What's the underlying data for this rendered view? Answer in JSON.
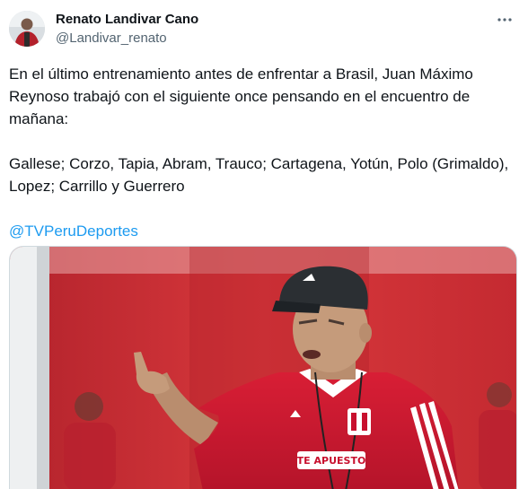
{
  "tweet": {
    "author": {
      "name": "Renato Landivar Cano",
      "handle": "@Landivar_renato"
    },
    "text": {
      "line1": "En el último entrenamiento antes de enfrentar a Brasil, Juan Máximo",
      "line2": "Reynoso trabajó con el siguiente once pensando en el encuentro de",
      "line3": "mañana:",
      "line4": "Gallese; Corzo, Tapia, Abram, Trauco; Cartagena, Yotún, Polo (Grimaldo),",
      "line5": "Lopez; Carrillo y Guerrero"
    },
    "mention": "@TVPeruDeportes",
    "media": {
      "shirt_text": "TE APUESTO"
    }
  },
  "colors": {
    "link": "#1d9bf0",
    "secondary_text": "#536471",
    "border": "#cfd9de",
    "shirt_red": "#c8102e"
  },
  "icons": {
    "more": "more-horizontal-icon",
    "avatar": "user-avatar"
  }
}
